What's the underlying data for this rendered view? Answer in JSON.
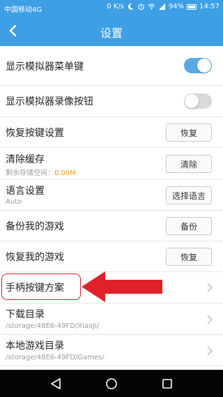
{
  "status_bar": {
    "carrier": "中国移动4G",
    "speed": "0 K/s",
    "battery": "94%",
    "time": "14:57"
  },
  "header": {
    "title": "设置",
    "back_icon": "back-arrow-icon"
  },
  "settings": {
    "show_menu_key": {
      "label": "显示模拟器菜单键",
      "enabled": true
    },
    "show_record_button": {
      "label": "显示模拟器录像按钮",
      "enabled": false
    },
    "restore_keys": {
      "label": "恢复按键设置",
      "button": "恢复"
    },
    "clear_cache": {
      "label": "清除缓存",
      "sub_prefix": "剩余存储空间：",
      "sub_value": "0.00M",
      "button": "清除"
    },
    "language": {
      "label": "语言设置",
      "sub": "Auto",
      "button": "选择语言"
    },
    "backup_games": {
      "label": "备份我的游戏",
      "button": "备份"
    },
    "restore_games": {
      "label": "恢复我的游戏",
      "button": "恢复"
    },
    "gamepad_scheme": {
      "label": "手柄按键方案"
    },
    "download_dir": {
      "label": "下载目录",
      "sub": "/storage/48E6-49FD/XiaoJi/"
    },
    "local_games_dir": {
      "label": "本地游戏目录",
      "sub": "/storage/48E6-49FD/Games/"
    }
  },
  "colors": {
    "primary": "#3f9fe4",
    "toggle_on": "#5aa9e6",
    "annotation_red": "#d81f26",
    "cache_value": "#f39c12"
  }
}
